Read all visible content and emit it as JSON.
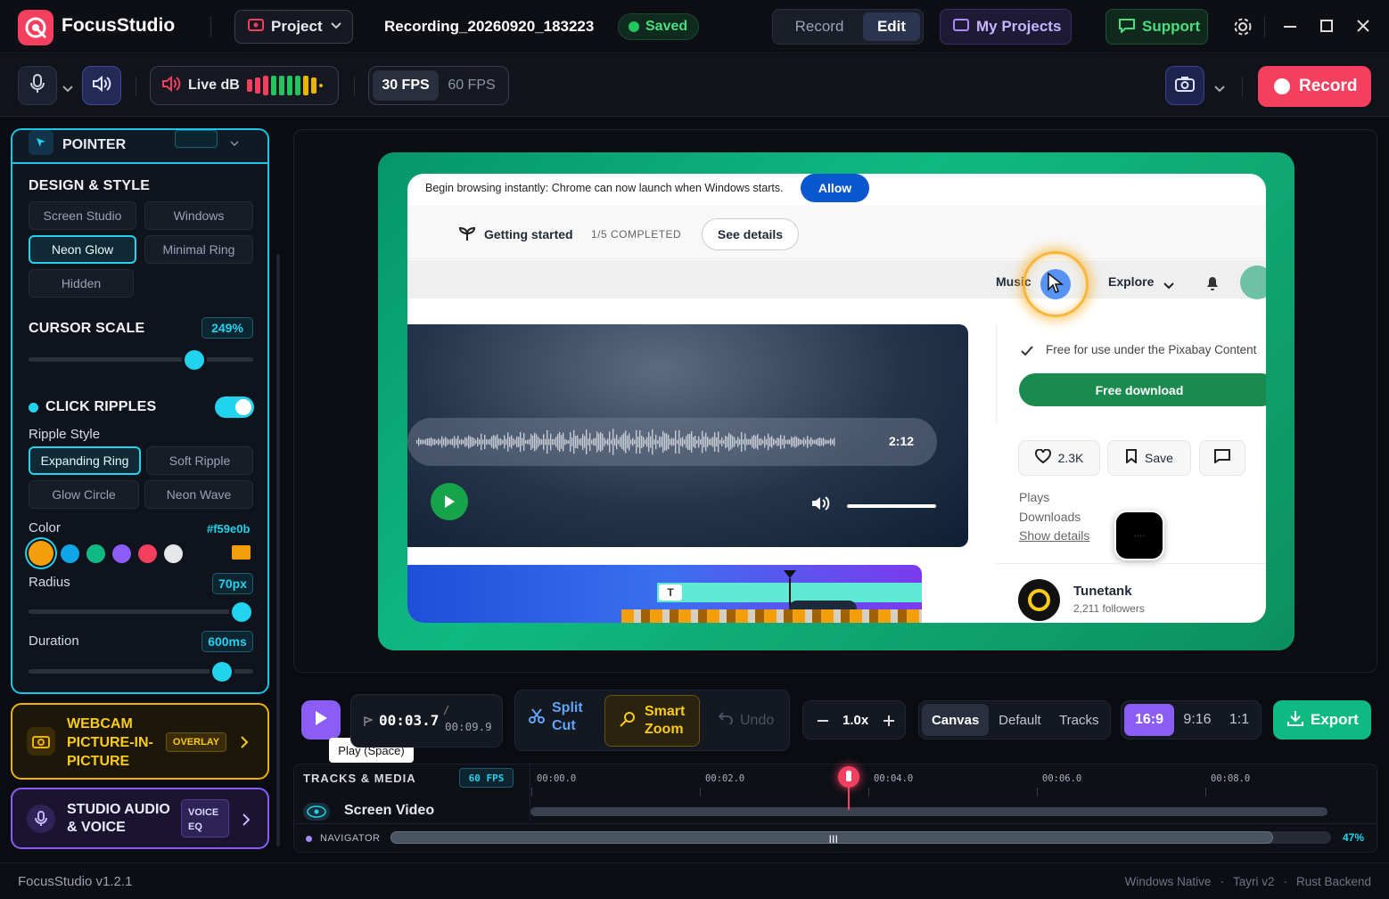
{
  "app": {
    "name": "FocusStudio",
    "project_label": "Project",
    "file_name": "Recording_20260920_183223",
    "saved_label": "Saved",
    "mode_tabs": [
      "Record",
      "Edit"
    ],
    "active_mode": "Edit",
    "my_projects": "My Projects",
    "support": "Support",
    "version": "FocusStudio v1.2.1",
    "footer_tags": [
      "Windows Native",
      "Tayri v2",
      "Rust Backend"
    ]
  },
  "toolbar": {
    "live_db_label": "Live dB",
    "fps_options": [
      "30 FPS",
      "60 FPS"
    ],
    "active_fps": "30 FPS",
    "record_label": "Record"
  },
  "sidebar": {
    "pointer_label": "POINTER",
    "design_title": "DESIGN & STYLE",
    "design_options": [
      "Screen Studio",
      "Windows",
      "Neon Glow",
      "Minimal Ring",
      "Hidden"
    ],
    "design_selected": "Neon Glow",
    "cursor_scale_label": "CURSOR SCALE",
    "cursor_scale_value": "249%",
    "cursor_scale_level": 0.74,
    "click_ripples_label": "CLICK RIPPLES",
    "click_ripples_on": true,
    "ripple_style_label": "Ripple Style",
    "ripple_options": [
      "Expanding Ring",
      "Soft Ripple",
      "Glow Circle",
      "Neon Wave"
    ],
    "ripple_selected": "Expanding Ring",
    "color_label": "Color",
    "color_value": "#f59e0b",
    "swatches": [
      "#f59e0b",
      "#0ea5e9",
      "#10b981",
      "#8b5cf6",
      "#f43f5e",
      "#e5e7eb"
    ],
    "radius_label": "Radius",
    "radius_value": "70px",
    "radius_level": 0.95,
    "duration_label": "Duration",
    "duration_value": "600ms",
    "duration_level": 0.86,
    "webcam_title": "WEBCAM PICTURE-IN-PICTURE",
    "webcam_badge": "OVERLAY",
    "audio_title": "STUDIO AUDIO & VOICE",
    "audio_badge": "VOICE EQ"
  },
  "preview": {
    "notice": "Begin browsing instantly: Chrome can now launch when Windows starts.",
    "allow": "Allow",
    "getting_started": "Getting started",
    "completed": "1/5 COMPLETED",
    "see_details": "See details",
    "music": "Music",
    "explore": "Explore",
    "duration": "2:12",
    "license_text": "Free for use under the Pixabay Content",
    "free_download": "Free download",
    "likes": "2.3K",
    "save": "Save",
    "plays": "Plays",
    "downloads": "Downloads",
    "show_details": "Show details",
    "artist": "Tunetank",
    "followers": "2,211 followers"
  },
  "playback": {
    "current_time": "00:03.7",
    "total_time": "00:09.9",
    "tooltip": "Play (Space)",
    "split_cut": "Split Cut",
    "smart_zoom": "Smart Zoom",
    "undo": "Undo",
    "speed": "1.0x",
    "view_options": [
      "Canvas",
      "Default",
      "Tracks"
    ],
    "view_selected": "Canvas",
    "aspect_options": [
      "16:9",
      "9:16",
      "1:1"
    ],
    "aspect_selected": "16:9",
    "export": "Export"
  },
  "timeline": {
    "title": "TRACKS & MEDIA",
    "fps_badge": "60 FPS",
    "ticks": [
      "00:00.0",
      "00:02.0",
      "00:04.0",
      "00:06.0",
      "00:08.0"
    ],
    "track_name": "Screen Video",
    "navigator": "NAVIGATOR",
    "zoom": "47%"
  },
  "colors": {
    "accent": "#22d3ee",
    "record": "#f43f5e",
    "export": "#10b981",
    "purple": "#8b5cf6"
  }
}
